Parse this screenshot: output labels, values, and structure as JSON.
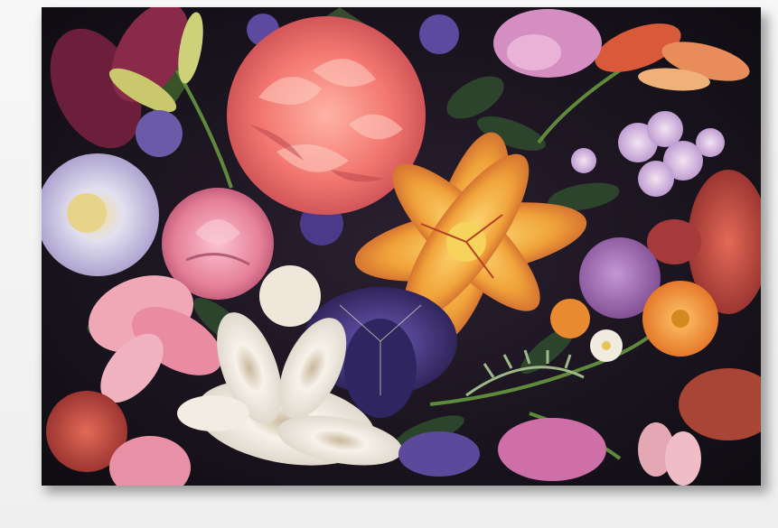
{
  "artwork": {
    "alt_description": "",
    "colors": {
      "background": "#151218",
      "carnation": "#f2766f",
      "lily": "#f0a23a",
      "iris": "#3b2f6e",
      "white_lily": "#f4efe6",
      "rose": "#ec8fa3",
      "lilac": "#c9a6d9",
      "leaf": "#2f4a2e",
      "gerbera": "#f0822c"
    }
  }
}
